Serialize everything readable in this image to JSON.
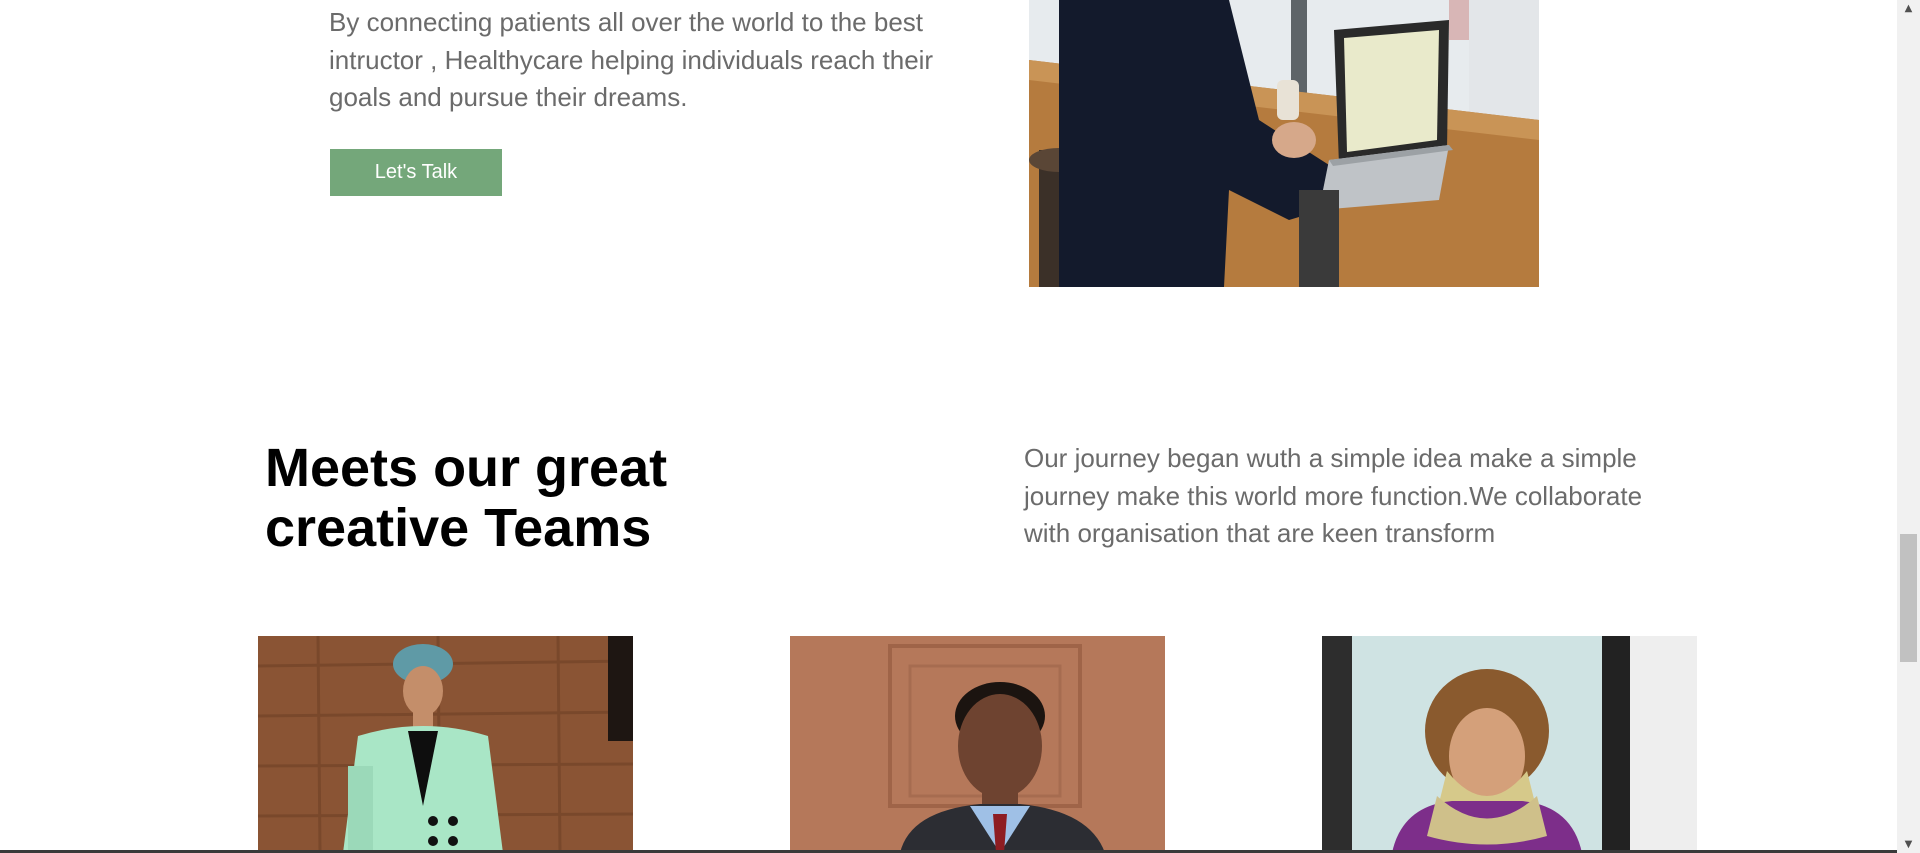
{
  "about": {
    "paragraph": "By connecting patients all over the world to the best intructor , Healthycare helping individuals reach their goals and pursue their dreams.",
    "cta_label": "Let's Talk"
  },
  "team": {
    "title_line1": "Meets our great",
    "title_line2": "creative Teams",
    "description": "Our journey began wuth a simple idea make a simple journey make this world more function.We collaborate with organisation that are keen transform"
  },
  "colors": {
    "accent": "#74a77a",
    "body_text": "#6b6b6b",
    "heading": "#000000"
  },
  "scrollbar": {
    "up_icon": "▲",
    "down_icon": "▼"
  }
}
